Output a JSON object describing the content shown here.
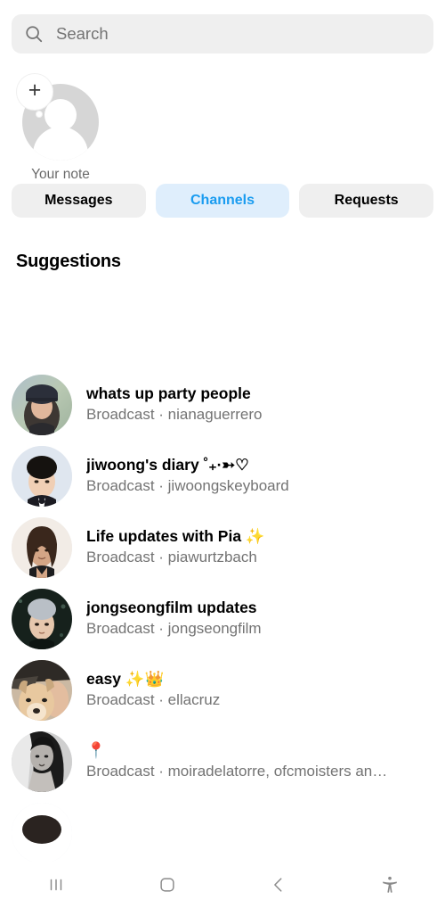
{
  "search": {
    "placeholder": "Search",
    "value": "",
    "icon": "search-icon"
  },
  "note": {
    "label": "Your note",
    "add_icon": "plus-icon",
    "avatar": "default-person-avatar"
  },
  "tabs": [
    {
      "label": "Messages",
      "active": false
    },
    {
      "label": "Channels",
      "active": true
    },
    {
      "label": "Requests",
      "active": false
    }
  ],
  "suggestions": {
    "heading": "Suggestions",
    "items": [
      {
        "title": "whats up party people",
        "subtitle": "Broadcast · nianaguerrero",
        "avatar_name": "avatar-nianaguerrero"
      },
      {
        "title": "jiwoong's diary ˚₊·➳♡",
        "subtitle": "Broadcast · jiwoongskeyboard",
        "avatar_name": "avatar-jiwoongskeyboard"
      },
      {
        "title": "Life updates with Pia ✨",
        "subtitle": "Broadcast · piawurtzbach",
        "avatar_name": "avatar-piawurtzbach"
      },
      {
        "title": "jongseongfilm updates",
        "subtitle": "Broadcast · jongseongfilm",
        "avatar_name": "avatar-jongseongfilm"
      },
      {
        "title": "easy ✨👑",
        "subtitle": "Broadcast · ellacruz",
        "avatar_name": "avatar-ellacruz"
      },
      {
        "title": "📍",
        "subtitle": "Broadcast · moiradelatorre, ofcmoisters an…",
        "avatar_name": "avatar-moiradelatorre"
      },
      {
        "title": "",
        "subtitle": "",
        "avatar_name": "avatar-partial-next"
      }
    ]
  },
  "navbar": {
    "buttons": [
      {
        "name": "recents-button",
        "icon": "recents-icon"
      },
      {
        "name": "home-button",
        "icon": "home-square-icon"
      },
      {
        "name": "back-button",
        "icon": "chevron-left-icon"
      },
      {
        "name": "accessibility-button",
        "icon": "accessibility-icon"
      }
    ]
  },
  "colors": {
    "accent_blue": "#1a9cf0",
    "tab_active_bg": "#dfeefc",
    "chip_bg": "#efefef",
    "muted_text": "#737373",
    "background": "#ffffff"
  }
}
